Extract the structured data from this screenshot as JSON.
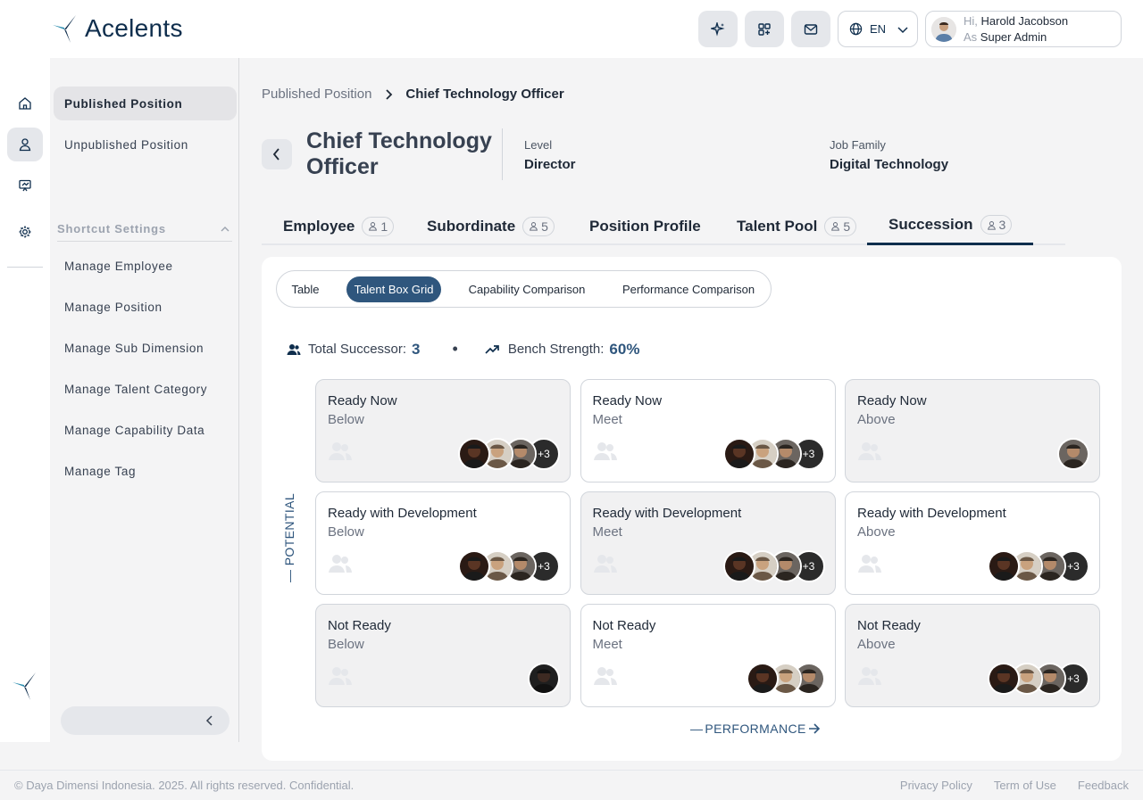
{
  "app": {
    "name": "Acelents"
  },
  "topbar": {
    "language": "EN",
    "greeting_prefix": "Hi,",
    "user_name": "Harold Jacobson",
    "role_prefix": "As",
    "role": "Super Admin",
    "icons": [
      "sparkle-icon",
      "apps-icon",
      "mail-icon",
      "globe-icon",
      "chevron-down-icon"
    ]
  },
  "rail": {
    "icons": [
      "home-icon",
      "user-icon",
      "presentation-icon",
      "gear-icon"
    ],
    "active": "user-icon"
  },
  "subnav": {
    "items": [
      "Published Position",
      "Unpublished Position"
    ],
    "active": "Published Position",
    "shortcut_title": "Shortcut Settings",
    "shortcuts": [
      "Manage Employee",
      "Manage Position",
      "Manage Sub Dimension",
      "Manage Talent Category",
      "Manage Capability Data",
      "Manage Tag"
    ]
  },
  "breadcrumb": {
    "parent": "Published Position",
    "current": "Chief Technology Officer"
  },
  "position": {
    "title": "Chief Technology Officer",
    "level_label": "Level",
    "level": "Director",
    "family_label": "Job Family",
    "family": "Digital Technology"
  },
  "tabs": [
    {
      "label": "Employee",
      "count": "1"
    },
    {
      "label": "Subordinate",
      "count": "5"
    },
    {
      "label": "Position Profile",
      "count": ""
    },
    {
      "label": "Talent Pool",
      "count": "5"
    },
    {
      "label": "Succession",
      "count": "3"
    }
  ],
  "active_tab": "Succession",
  "views": {
    "options": [
      "Table",
      "Talent Box Grid",
      "Capability Comparison",
      "Performance Comparison"
    ],
    "selected": "Talent Box Grid"
  },
  "stats": {
    "successor_label": "Total Successor:",
    "successor_value": "3",
    "bench_label": "Bench Strength:",
    "bench_value": "60%"
  },
  "grid": {
    "y_axis": "POTENTIAL",
    "x_axis": "PERFORMANCE",
    "cells": [
      {
        "row": "Ready Now",
        "col": "Below",
        "avatars": 3,
        "more": "+3"
      },
      {
        "row": "Ready Now",
        "col": "Meet",
        "avatars": 3,
        "more": "+3"
      },
      {
        "row": "Ready Now",
        "col": "Above",
        "avatars": 1,
        "more": ""
      },
      {
        "row": "Ready with Development",
        "col": "Below",
        "avatars": 3,
        "more": "+3"
      },
      {
        "row": "Ready with Development",
        "col": "Meet",
        "avatars": 3,
        "more": "+3"
      },
      {
        "row": "Ready with Development",
        "col": "Above",
        "avatars": 3,
        "more": "+3"
      },
      {
        "row": "Not Ready",
        "col": "Below",
        "avatars": 1,
        "more": ""
      },
      {
        "row": "Not Ready",
        "col": "Meet",
        "avatars": 3,
        "more": ""
      },
      {
        "row": "Not Ready",
        "col": "Above",
        "avatars": 3,
        "more": "+3"
      }
    ]
  },
  "footer": {
    "copyright": "© Daya Dimensi Indonesia. 2025. All rights reserved. Confidential.",
    "links": [
      "Privacy Policy",
      "Term of Use",
      "Feedback"
    ]
  }
}
